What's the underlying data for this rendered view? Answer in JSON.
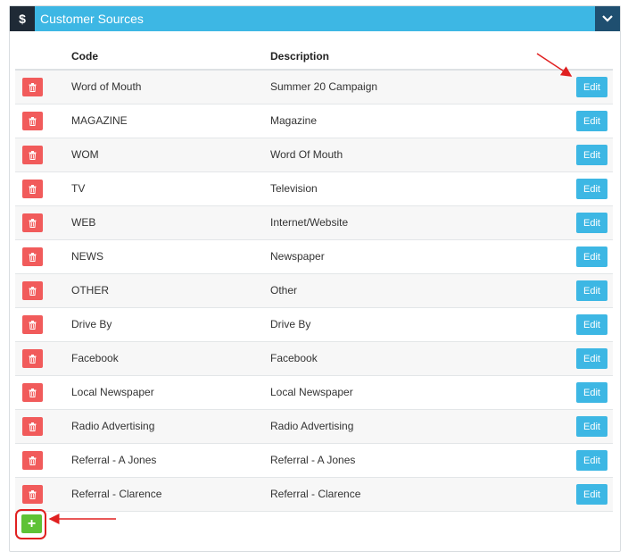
{
  "panel": {
    "icon": "$",
    "icon_name": "dollar-icon",
    "title": "Customer Sources",
    "toggle_icon": "chevron-down-icon"
  },
  "table": {
    "headers": {
      "code": "Code",
      "description": "Description"
    },
    "edit_label": "Edit",
    "delete_icon": "trash-icon",
    "rows": [
      {
        "code": "Word of Mouth",
        "description": "Summer 20 Campaign"
      },
      {
        "code": "MAGAZINE",
        "description": "Magazine"
      },
      {
        "code": "WOM",
        "description": "Word Of Mouth"
      },
      {
        "code": "TV",
        "description": "Television"
      },
      {
        "code": "WEB",
        "description": "Internet/Website"
      },
      {
        "code": "NEWS",
        "description": "Newspaper"
      },
      {
        "code": "OTHER",
        "description": "Other"
      },
      {
        "code": "Drive By",
        "description": "Drive By"
      },
      {
        "code": "Facebook",
        "description": "Facebook"
      },
      {
        "code": "Local Newspaper",
        "description": "Local Newspaper"
      },
      {
        "code": "Radio Advertising",
        "description": "Radio Advertising"
      },
      {
        "code": "Referral - A Jones",
        "description": "Referral - A Jones"
      },
      {
        "code": "Referral - Clarence",
        "description": "Referral - Clarence"
      }
    ]
  },
  "add_button": {
    "label": "+"
  },
  "colors": {
    "header": "#3db7e4",
    "delete": "#f15b5b",
    "edit": "#3db7e4",
    "add": "#5ec236",
    "annotation": "#e02020"
  }
}
